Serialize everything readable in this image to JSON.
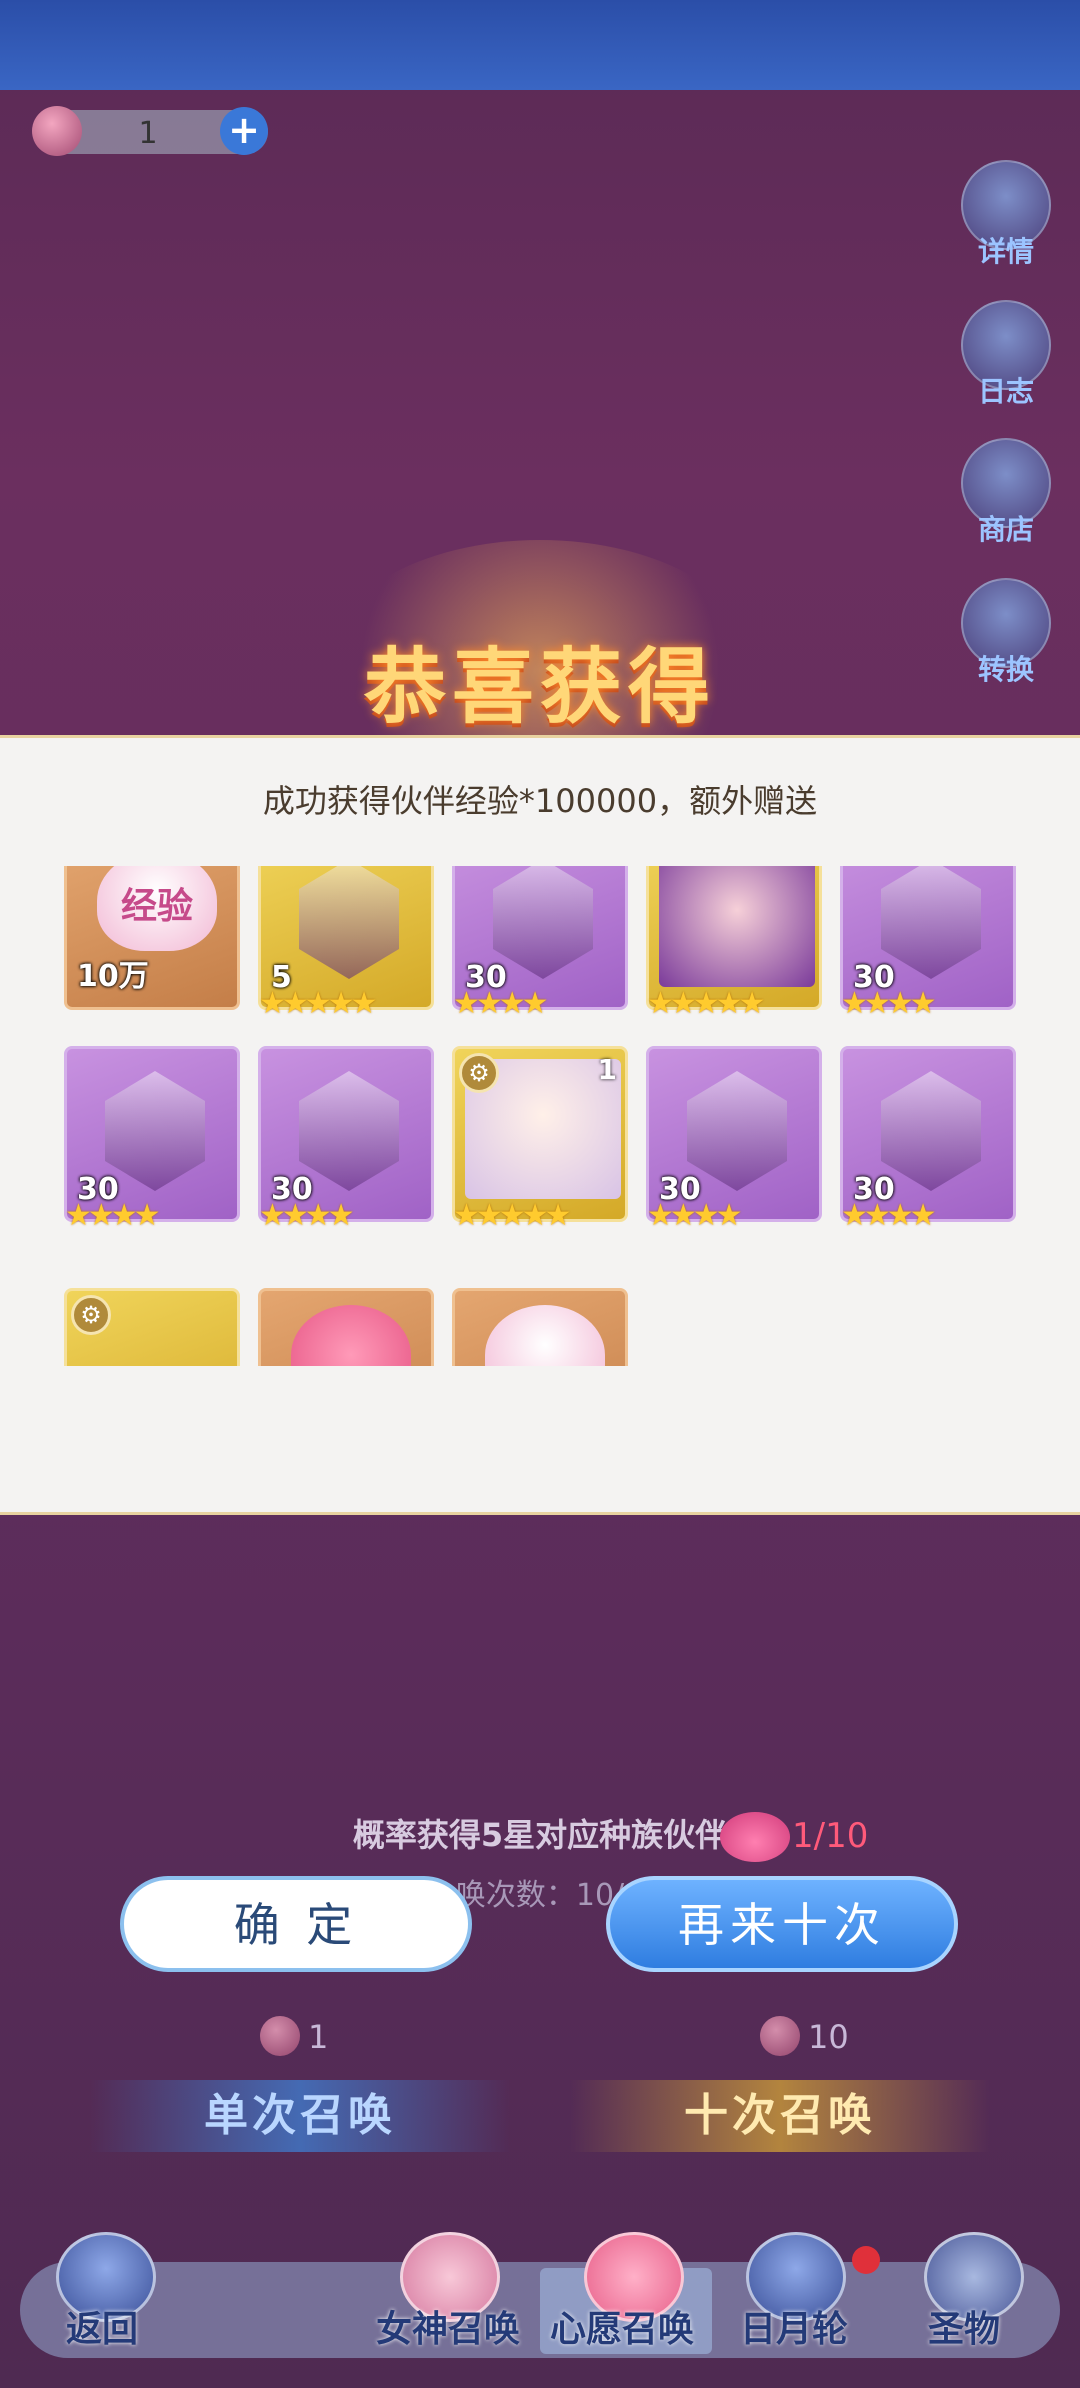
{
  "currency": {
    "value": "1",
    "plus": "+"
  },
  "side_buttons": [
    {
      "label": "详情",
      "icon": "magnifier-icon"
    },
    {
      "label": "日志",
      "icon": "book-icon"
    },
    {
      "label": "商店",
      "icon": "shop-icon"
    },
    {
      "label": "转换",
      "icon": "convert-icon"
    }
  ],
  "reward": {
    "title": "恭喜获得",
    "subtitle": "成功获得伙伴经验*100000，额外赠送",
    "items": [
      {
        "kind": "exp",
        "count": "10万",
        "label": "经验",
        "stars": 0,
        "color": "bronze"
      },
      {
        "kind": "shard",
        "count": "5",
        "stars": 5,
        "color": "gold"
      },
      {
        "kind": "shard",
        "count": "30",
        "stars": 4,
        "color": "purple"
      },
      {
        "kind": "hero",
        "count": "",
        "stars": 5,
        "color": "purple"
      },
      {
        "kind": "shard",
        "count": "30",
        "stars": 4,
        "color": "purple"
      },
      {
        "kind": "shard",
        "count": "30",
        "stars": 4,
        "color": "purple"
      },
      {
        "kind": "shard",
        "count": "30",
        "stars": 4,
        "color": "purple"
      },
      {
        "kind": "hero",
        "count": "1",
        "stars": 5,
        "color": "gold"
      },
      {
        "kind": "shard",
        "count": "30",
        "stars": 4,
        "color": "purple"
      },
      {
        "kind": "shard",
        "count": "30",
        "stars": 4,
        "color": "purple"
      },
      {
        "kind": "partial",
        "count": "",
        "stars": 0,
        "color": "gold"
      },
      {
        "kind": "partial",
        "count": "",
        "stars": 0,
        "color": "bronze"
      },
      {
        "kind": "partial",
        "count": "",
        "stars": 0,
        "color": "bronze"
      }
    ]
  },
  "probability_text": "概率获得5星对应种族伙伴",
  "summon_count_text": "唤次数：10/",
  "wish_counter": "1/10",
  "buttons": {
    "confirm": "确 定",
    "again": "再来十次"
  },
  "costs": {
    "single": "1",
    "ten": "10"
  },
  "summon": {
    "single": "单次召唤",
    "ten": "十次召唤"
  },
  "nav": {
    "back": "返回",
    "goddess": "女神召唤",
    "wish": "心愿召唤",
    "sunmoon": "日月轮",
    "relic": "圣物"
  },
  "colors": {
    "accent": "#3a78d8",
    "title": "#ffd778",
    "counter": "#ff5a7a"
  }
}
